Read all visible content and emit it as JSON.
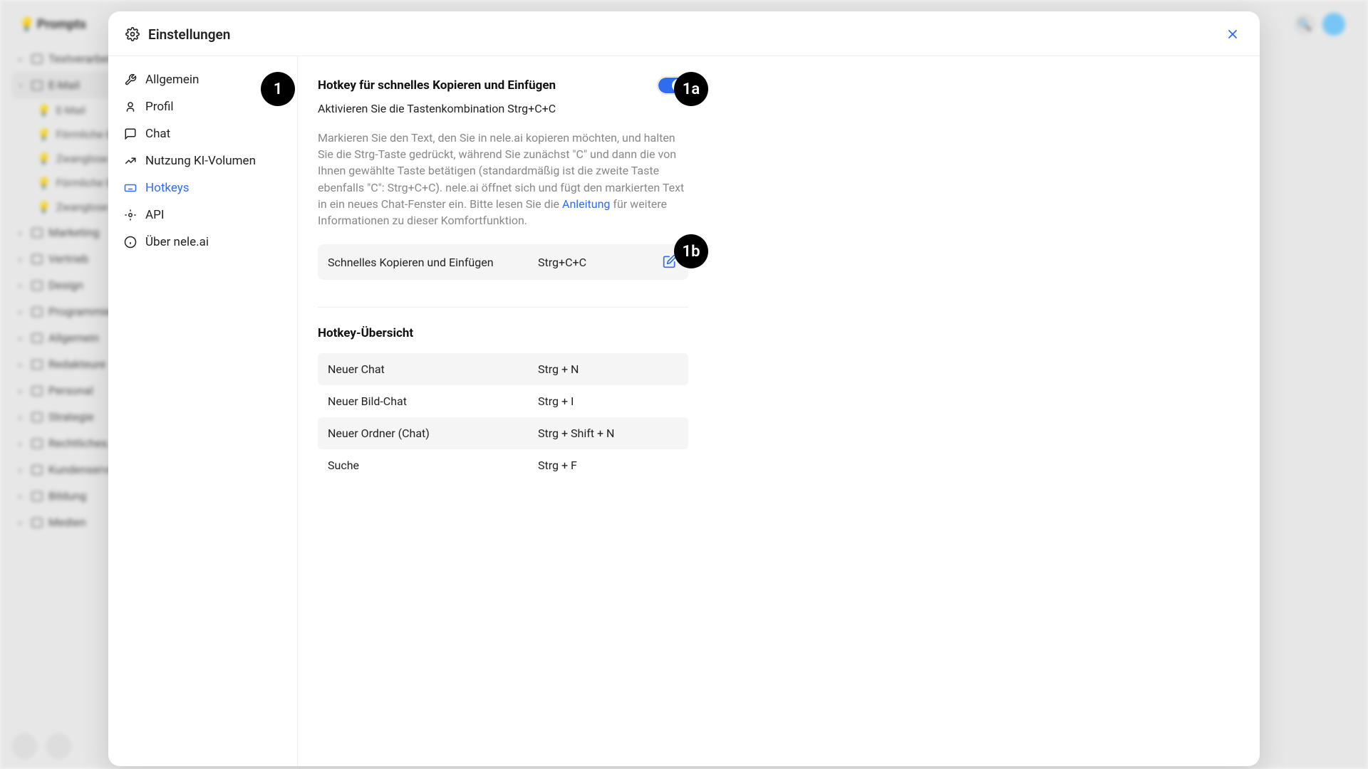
{
  "bg": {
    "prompts_label": "Prompts",
    "side_items": [
      {
        "label": "Textverarbeiter",
        "type": "folder"
      },
      {
        "label": "E-Mail",
        "type": "folder",
        "expanded": true,
        "children": [
          {
            "label": "E-Mail"
          },
          {
            "label": "Förmliche E-…"
          },
          {
            "label": "Zwanglose E…"
          },
          {
            "label": "Förmliche E-…"
          },
          {
            "label": "Zwanglose E…"
          }
        ]
      },
      {
        "label": "Marketing",
        "type": "folder"
      },
      {
        "label": "Vertrieb",
        "type": "folder"
      },
      {
        "label": "Design",
        "type": "folder"
      },
      {
        "label": "Programmier…",
        "type": "folder"
      },
      {
        "label": "Allgemein",
        "type": "folder"
      },
      {
        "label": "Redakteure",
        "type": "folder"
      },
      {
        "label": "Personal",
        "type": "folder"
      },
      {
        "label": "Strategie",
        "type": "folder"
      },
      {
        "label": "Rechtliches…",
        "type": "folder"
      },
      {
        "label": "Kundenservice",
        "type": "folder"
      },
      {
        "label": "Bildung",
        "type": "folder"
      },
      {
        "label": "Medien",
        "type": "folder"
      }
    ]
  },
  "modal": {
    "title": "Einstellungen",
    "nav": [
      {
        "key": "allgemein",
        "label": "Allgemein"
      },
      {
        "key": "profil",
        "label": "Profil"
      },
      {
        "key": "chat",
        "label": "Chat"
      },
      {
        "key": "nutzung",
        "label": "Nutzung KI-Volumen"
      },
      {
        "key": "hotkeys",
        "label": "Hotkeys",
        "active": true
      },
      {
        "key": "api",
        "label": "API"
      },
      {
        "key": "ueber",
        "label": "Über nele.ai"
      }
    ]
  },
  "content": {
    "section_title": "Hotkey für schnelles Kopieren und Einfügen",
    "subtitle": "Aktivieren Sie die Tastenkombination Strg+C+C",
    "desc_pre": "Markieren Sie den Text, den Sie in nele.ai kopieren möchten, und halten Sie die Strg-Taste gedrückt, während Sie zunächst \"C\" und dann die von Ihnen gewählte Taste betätigen (standardmäßig ist die zweite Taste ebenfalls \"C\": Strg+C+C). nele.ai öffnet sich und fügt den markierten Text in ein neues Chat-Fenster ein. Bitte lesen Sie die ",
    "desc_link": "Anleitung",
    "desc_post": " für weitere Informationen zu dieser Komfortfunktion.",
    "quick_copy": {
      "label": "Schnelles Kopieren und Einfügen",
      "keys": "Strg+C+C"
    },
    "overview_title": "Hotkey-Übersicht",
    "overview": [
      {
        "label": "Neuer Chat",
        "keys": "Strg + N"
      },
      {
        "label": "Neuer Bild-Chat",
        "keys": "Strg + I"
      },
      {
        "label": "Neuer Ordner (Chat)",
        "keys": "Strg + Shift + N"
      },
      {
        "label": "Suche",
        "keys": "Strg + F"
      }
    ]
  },
  "annotations": {
    "a1": "1",
    "a1a": "1a",
    "a1b": "1b"
  }
}
